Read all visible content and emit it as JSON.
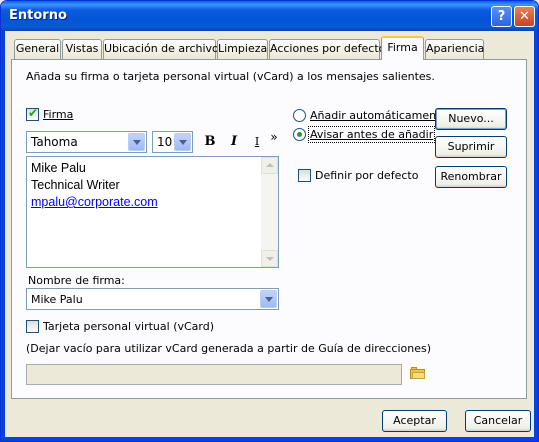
{
  "window": {
    "title": "Entorno",
    "help_label": "?",
    "close_label": "✕"
  },
  "tabs": [
    {
      "label": "General"
    },
    {
      "label": "Vistas"
    },
    {
      "label": "Ubicación de archivo"
    },
    {
      "label": "Limpieza"
    },
    {
      "label": "Acciones por defecto"
    },
    {
      "label": "Firma"
    },
    {
      "label": "Apariencia"
    }
  ],
  "active_tab": "Firma",
  "signature": {
    "description": "Añada su firma o tarjeta personal virtual (vCard) a los mensajes salientes.",
    "firma_label": "Firma",
    "firma_checked": true,
    "font_name": "Tahoma",
    "font_size": "10",
    "bold_label": "B",
    "italic_label": "I",
    "underline_label": "I",
    "more_label": "»",
    "body_lines": [
      "Mike Palu",
      "Technical Writer"
    ],
    "body_link": "mpalu@corporate.com",
    "name_label": "Nombre de firma:",
    "name_value": "Mike Palu"
  },
  "options": {
    "auto_add_label": "Añadir automáticamente",
    "ask_before_label": "Avisar antes de añadir",
    "selected": "ask_before",
    "default_label": "Definir por defecto",
    "default_checked": false
  },
  "buttons": {
    "new": "Nuevo...",
    "delete": "Suprimir",
    "rename": "Renombrar",
    "accept": "Aceptar",
    "cancel": "Cancelar"
  },
  "vcard": {
    "label": "Tarjeta personal virtual (vCard)",
    "checked": false,
    "hint": "(Dejar vacío para utilizar vCard generada a partir de Guía de direcciones)",
    "path_value": ""
  }
}
